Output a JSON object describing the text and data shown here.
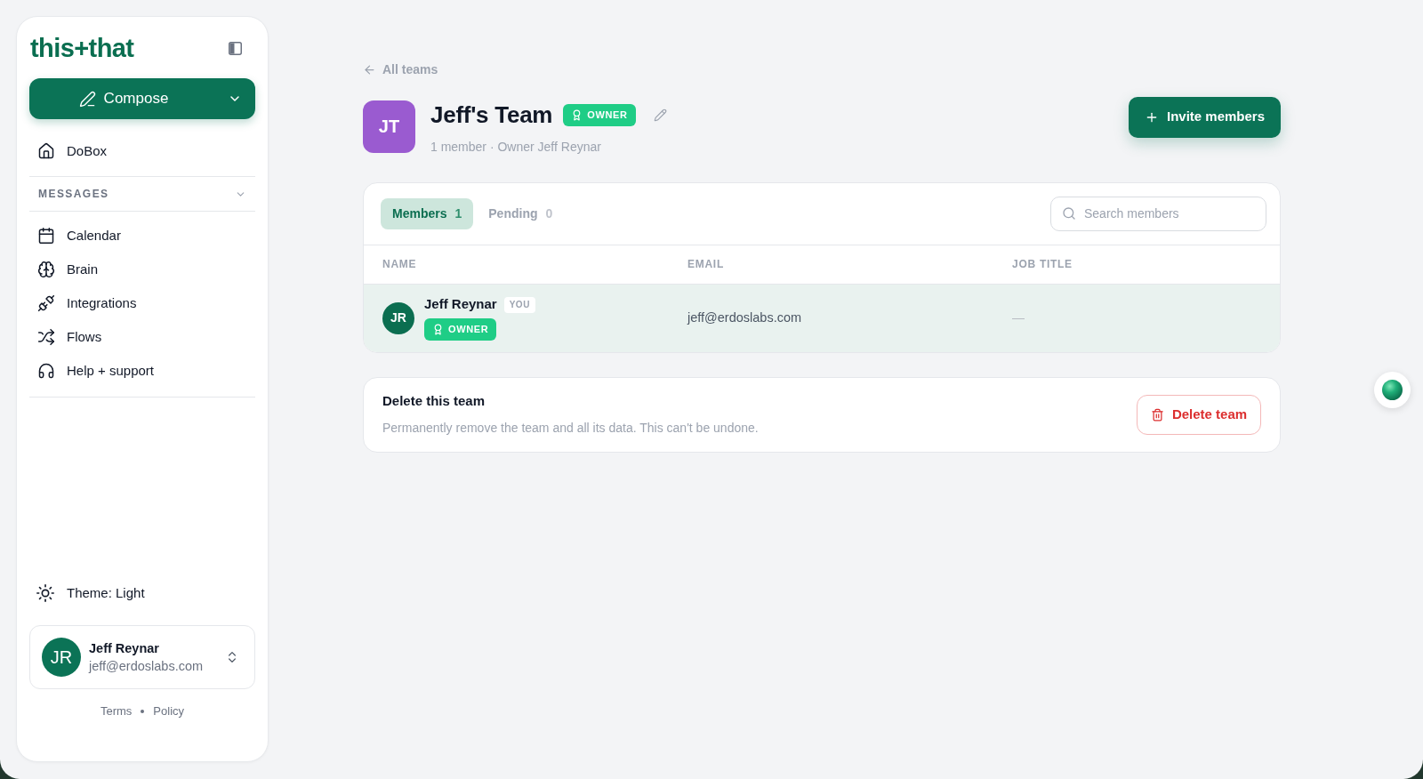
{
  "sidebar": {
    "logo": "this+that",
    "compose_button": "Compose",
    "top_items": [
      {
        "label": "DoBox"
      }
    ],
    "section_label": "MESSAGES",
    "items": [
      {
        "label": "Calendar"
      },
      {
        "label": "Brain"
      },
      {
        "label": "Integrations"
      },
      {
        "label": "Flows"
      },
      {
        "label": "Help + support"
      }
    ],
    "theme_toggle": "Theme: Light",
    "account": {
      "initials": "JR",
      "name": "Jeff Reynar",
      "email": "jeff@erdoslabs.com"
    },
    "footer_links": [
      "Terms",
      "Policy"
    ]
  },
  "page": {
    "back_link": "All teams",
    "team": {
      "initials": "JT",
      "name": "Jeff's Team",
      "badge": "OWNER",
      "subtitle": "1 member · Owner Jeff Reynar"
    },
    "invite_button": "Invite members",
    "tabs": [
      {
        "label": "Members",
        "count": "1",
        "selected": true
      },
      {
        "label": "Pending",
        "count": "0",
        "selected": false
      }
    ],
    "search": {
      "placeholder": "Search members"
    },
    "table": {
      "columns": [
        "NAME",
        "EMAIL",
        "JOB TITLE"
      ],
      "rows": [
        {
          "initials": "JR",
          "name": "Jeff Reynar",
          "tag": "YOU",
          "role": "OWNER",
          "email": "jeff@erdoslabs.com",
          "job_title": "—",
          "selected": true
        }
      ]
    },
    "danger_zone": {
      "title": "Delete this team",
      "description": "Permanently remove the team and all its data. This can't be undone.",
      "button": "Delete team"
    }
  }
}
